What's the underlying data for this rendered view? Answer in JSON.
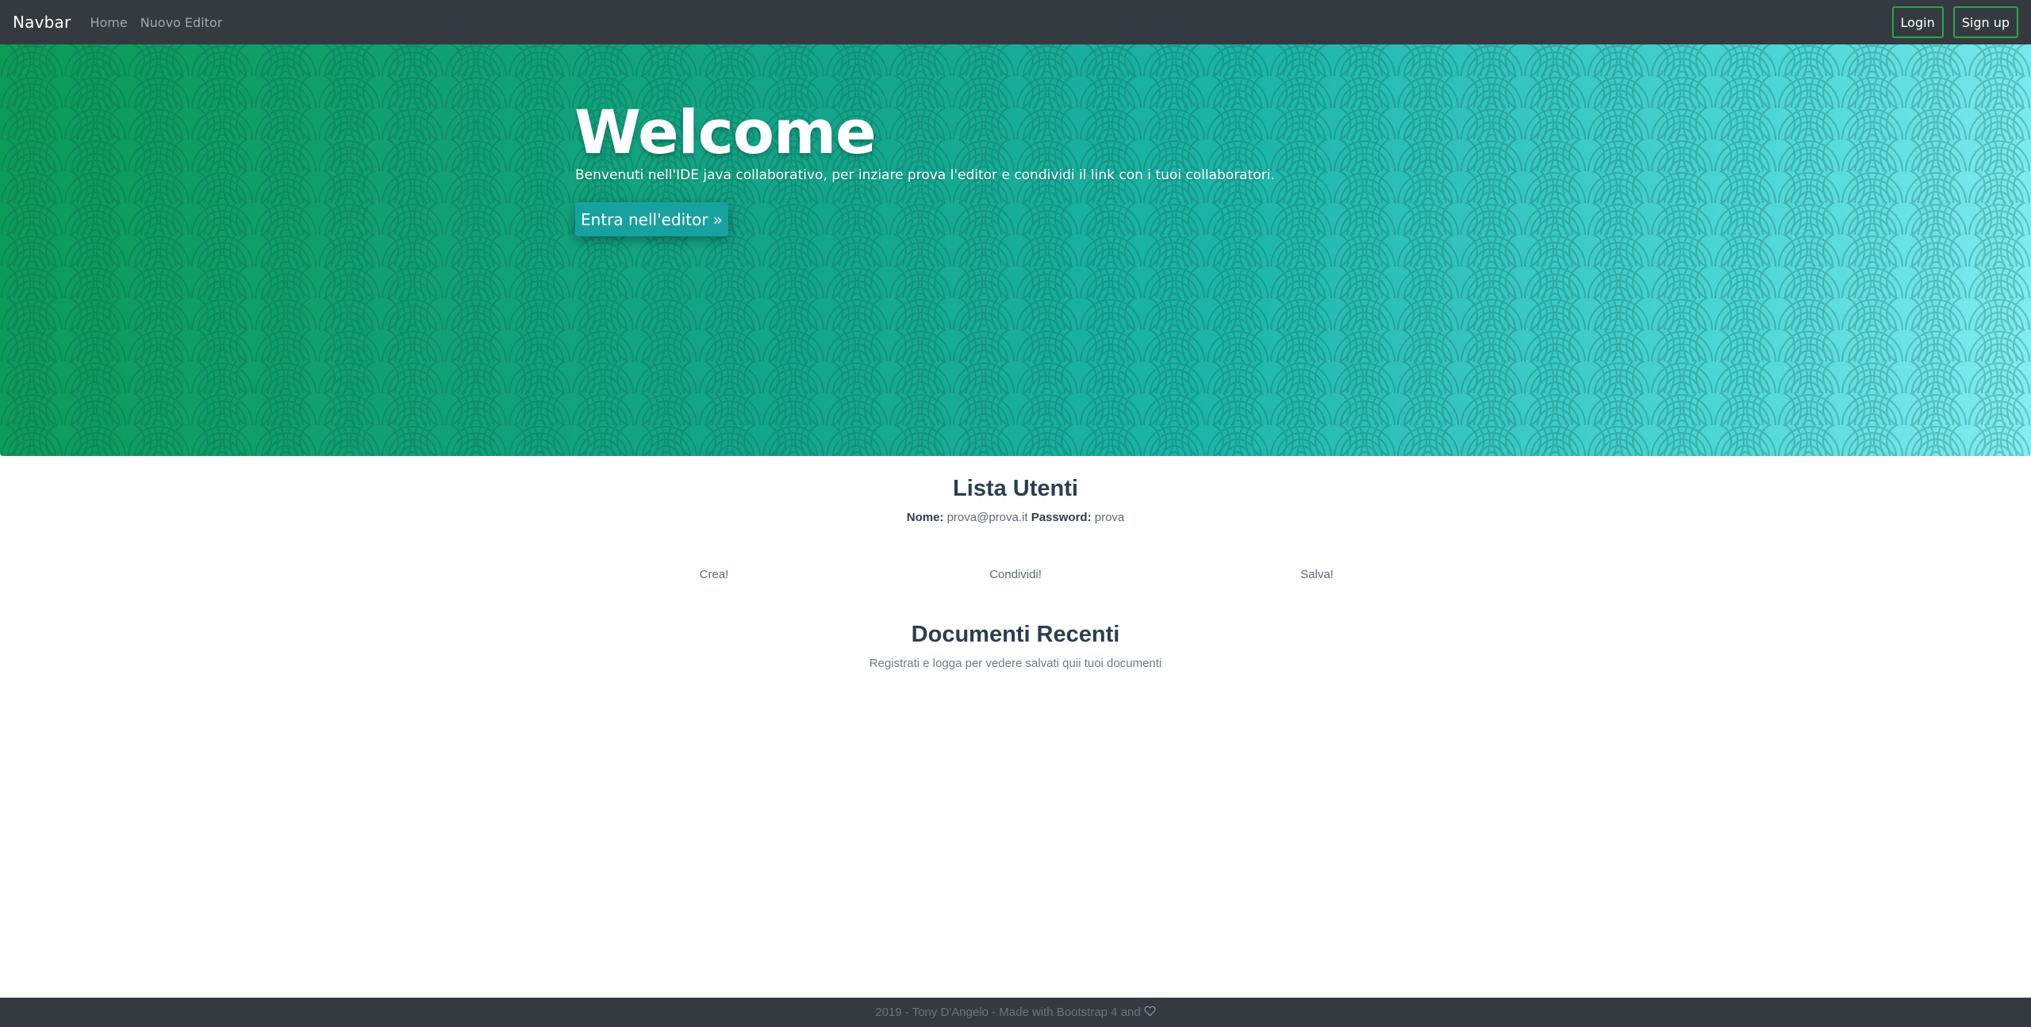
{
  "navbar": {
    "brand": "Navbar",
    "links": [
      "Home",
      "Nuovo Editor"
    ],
    "login_label": "Login",
    "signup_label": "Sign up"
  },
  "hero": {
    "title": "Welcome",
    "subtitle": "Benvenuti nell'IDE java collaborativo, per inziare prova l'editor e condividi il link con i tuoi collaboratori.",
    "cta_label": "Entra nell'editor »"
  },
  "users": {
    "heading": "Lista Utenti",
    "name_label": "Nome:",
    "name_value": "prova@prova.it",
    "password_label": "Password:",
    "password_value": "prova"
  },
  "features": [
    "Crea!",
    "Condividi!",
    "Salva!"
  ],
  "documents": {
    "heading": "Documenti Recenti",
    "empty_text": "Registrati e logga per vedere salvati quii tuoi documenti"
  },
  "footer": {
    "text": "2019 - Tony D'Angelo - Made with Bootstrap 4 and",
    "icon": "heart-icon"
  },
  "colors": {
    "navbar_bg": "#343a40",
    "accent_outline": "#28a745",
    "hero_gradient_start": "#0e9a57",
    "hero_gradient_end": "#86eef2",
    "hero_button": "#17a2a0"
  }
}
